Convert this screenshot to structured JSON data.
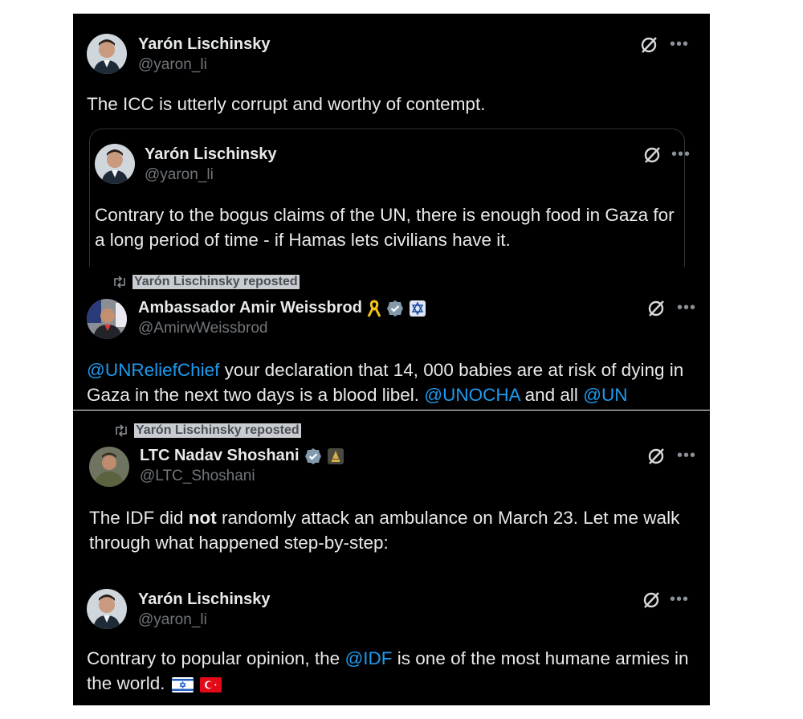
{
  "tweets": [
    {
      "name": "Yarón Lischinsky",
      "handle": "@yaron_li",
      "text": "The ICC is utterly corrupt and worthy of contempt."
    },
    {
      "name": "Yarón Lischinsky",
      "handle": "@yaron_li",
      "text": "Contrary to the bogus claims of the UN, there is enough food in Gaza for a long period of time - if Hamas lets civilians have it."
    },
    {
      "repost_label": "Yarón Lischinsky reposted",
      "name": "Ambassador Amir Weissbrod",
      "handle": "@AmirwWeissbrod",
      "text_parts": [
        "@UNReliefChief",
        " your declaration that 14, 000 babies are at risk of dying in Gaza in the next two days is a blood libel. ",
        "@UNOCHA",
        " and all ",
        "@UN"
      ]
    },
    {
      "repost_label": "Yarón Lischinsky reposted",
      "name": "LTC Nadav Shoshani",
      "handle": "@LTC_Shoshani",
      "text_parts": [
        "The IDF did ",
        "not",
        " randomly attack an ambulance on March 23. Let me walk through what happened step-by-step:"
      ]
    },
    {
      "name": "Yarón Lischinsky",
      "handle": "@yaron_li",
      "text_parts": [
        "Contrary to popular opinion, the ",
        "@IDF",
        " is one of the most humane armies in the world."
      ]
    }
  ],
  "icons": {
    "grok": "grok-slash-circle-icon",
    "more": "more-dots-icon",
    "repost": "repost-icon",
    "verified": "verified-badge-icon",
    "ribbon": "yellow-ribbon-icon"
  },
  "colors": {
    "background": "#000000",
    "mention": "#1d9bf0",
    "text": "#e7e9ea",
    "muted": "#71767b"
  }
}
